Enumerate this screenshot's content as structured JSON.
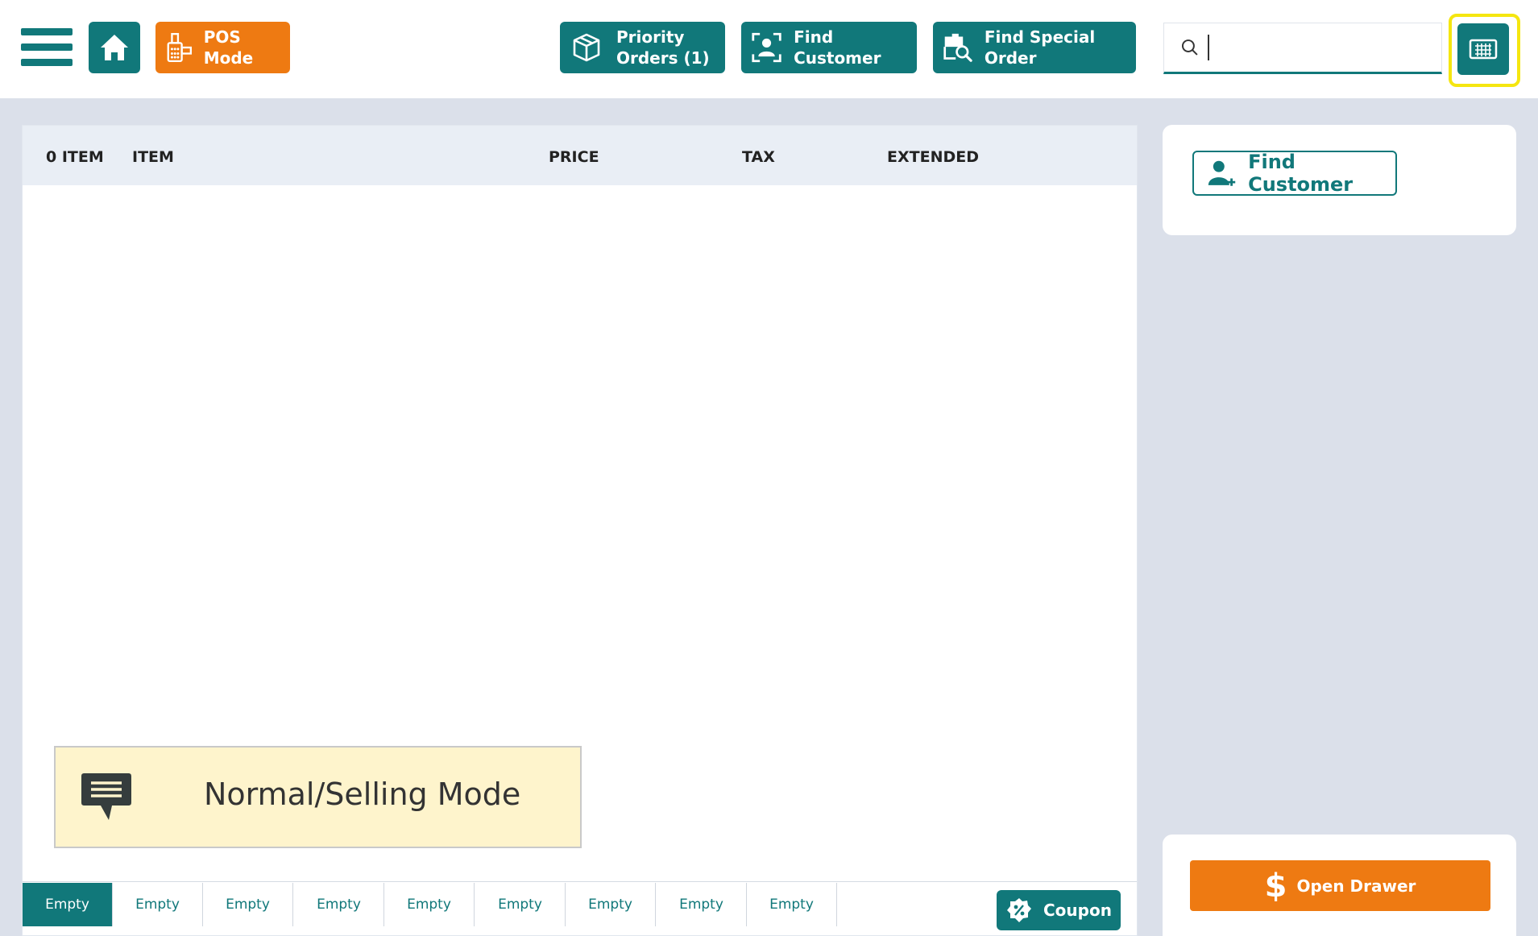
{
  "topbar": {
    "pos_mode_label": "POS Mode",
    "priority_orders_line1": "Priority",
    "priority_orders_line2": "Orders (1)",
    "find_customer_label": "Find Customer",
    "find_special_order_label": "Find Special Order",
    "search_value": ""
  },
  "table": {
    "headers": {
      "count": "0 ITEM",
      "item": "ITEM",
      "price": "PRICE",
      "tax": "TAX",
      "extended": "EXTENDED"
    }
  },
  "mode_banner": {
    "text": "Normal/Selling Mode"
  },
  "tabs": [
    {
      "label": "Empty",
      "active": true
    },
    {
      "label": "Empty",
      "active": false
    },
    {
      "label": "Empty",
      "active": false
    },
    {
      "label": "Empty",
      "active": false
    },
    {
      "label": "Empty",
      "active": false
    },
    {
      "label": "Empty",
      "active": false
    },
    {
      "label": "Empty",
      "active": false
    },
    {
      "label": "Empty",
      "active": false
    },
    {
      "label": "Empty",
      "active": false
    }
  ],
  "coupon_label": "Coupon",
  "customer_panel": {
    "find_customer_label": "Find Customer"
  },
  "drawer": {
    "open_drawer_label": "Open Drawer"
  },
  "colors": {
    "teal": "#11787a",
    "orange": "#ee7a12",
    "banner": "#fef4cc",
    "highlight": "#f5e610"
  }
}
